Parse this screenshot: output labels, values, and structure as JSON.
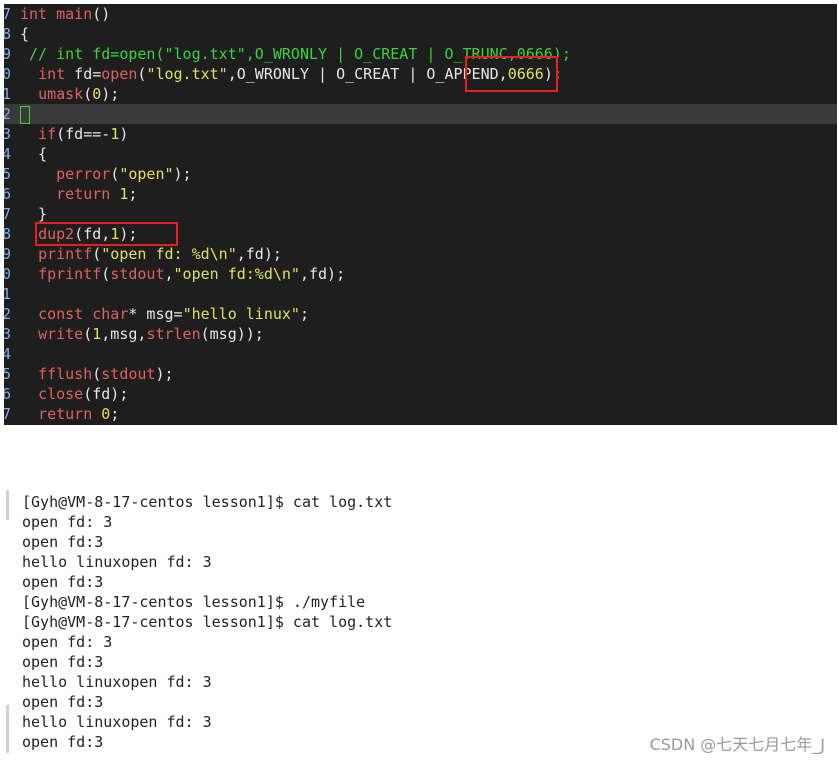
{
  "editor": {
    "lines": [
      {
        "gutter": "7",
        "parts": [
          [
            "kw",
            "int"
          ],
          [
            "plain",
            " "
          ],
          [
            "fn",
            "main"
          ],
          [
            "plain",
            "()"
          ]
        ]
      },
      {
        "gutter": "8",
        "parts": [
          [
            "plain",
            "{"
          ]
        ]
      },
      {
        "gutter": "9",
        "parts": [
          [
            "cm",
            " // int fd=open(\"log.txt\",O_WRONLY | O_CREAT | O_TRUNC,0666);"
          ]
        ]
      },
      {
        "gutter": "0",
        "parts": [
          [
            "plain",
            "  "
          ],
          [
            "kw",
            "int"
          ],
          [
            "plain",
            " fd="
          ],
          [
            "fn",
            "open"
          ],
          [
            "plain",
            "("
          ],
          [
            "str",
            "\"log.txt\""
          ],
          [
            "plain",
            ",O_WRONLY | O_CREAT | O_APPEND,"
          ],
          [
            "num",
            "0666"
          ],
          [
            "plain",
            ");"
          ]
        ]
      },
      {
        "gutter": "1",
        "parts": [
          [
            "plain",
            "  "
          ],
          [
            "fn",
            "umask"
          ],
          [
            "plain",
            "("
          ],
          [
            "num",
            "0"
          ],
          [
            "plain",
            ");"
          ]
        ]
      },
      {
        "gutter": "2",
        "parts": [
          [
            "cursor",
            ""
          ]
        ],
        "current": true
      },
      {
        "gutter": "3",
        "parts": [
          [
            "plain",
            "  "
          ],
          [
            "kw",
            "if"
          ],
          [
            "plain",
            "(fd==-"
          ],
          [
            "num",
            "1"
          ],
          [
            "plain",
            ")"
          ]
        ]
      },
      {
        "gutter": "4",
        "parts": [
          [
            "plain",
            "  {"
          ]
        ]
      },
      {
        "gutter": "5",
        "parts": [
          [
            "plain",
            "    "
          ],
          [
            "fn",
            "perror"
          ],
          [
            "plain",
            "("
          ],
          [
            "str",
            "\"open\""
          ],
          [
            "plain",
            ");"
          ]
        ]
      },
      {
        "gutter": "6",
        "parts": [
          [
            "plain",
            "    "
          ],
          [
            "kw",
            "return"
          ],
          [
            "plain",
            " "
          ],
          [
            "num",
            "1"
          ],
          [
            "plain",
            ";"
          ]
        ]
      },
      {
        "gutter": "7",
        "parts": [
          [
            "plain",
            "  }"
          ]
        ]
      },
      {
        "gutter": "8",
        "parts": [
          [
            "plain",
            "  "
          ],
          [
            "fn",
            "dup2"
          ],
          [
            "plain",
            "(fd,"
          ],
          [
            "num",
            "1"
          ],
          [
            "plain",
            ");"
          ]
        ]
      },
      {
        "gutter": "9",
        "parts": [
          [
            "plain",
            "  "
          ],
          [
            "fn",
            "printf"
          ],
          [
            "plain",
            "("
          ],
          [
            "str",
            "\"open fd: %d\\n\""
          ],
          [
            "plain",
            ",fd);"
          ]
        ]
      },
      {
        "gutter": "0",
        "parts": [
          [
            "plain",
            "  "
          ],
          [
            "fn",
            "fprintf"
          ],
          [
            "plain",
            "("
          ],
          [
            "kw",
            "stdout"
          ],
          [
            "plain",
            ","
          ],
          [
            "str",
            "\"open fd:%d\\n\""
          ],
          [
            "plain",
            ",fd);"
          ]
        ]
      },
      {
        "gutter": "1",
        "parts": [
          [
            "plain",
            ""
          ]
        ]
      },
      {
        "gutter": "2",
        "parts": [
          [
            "plain",
            "  "
          ],
          [
            "kw",
            "const"
          ],
          [
            "plain",
            " "
          ],
          [
            "kw",
            "char"
          ],
          [
            "plain",
            "* msg="
          ],
          [
            "str",
            "\"hello linux\""
          ],
          [
            "plain",
            ";"
          ]
        ]
      },
      {
        "gutter": "3",
        "parts": [
          [
            "plain",
            "  "
          ],
          [
            "fn",
            "write"
          ],
          [
            "plain",
            "("
          ],
          [
            "num",
            "1"
          ],
          [
            "plain",
            ",msg,"
          ],
          [
            "fn",
            "strlen"
          ],
          [
            "plain",
            "(msg));"
          ]
        ]
      },
      {
        "gutter": "4",
        "parts": [
          [
            "plain",
            ""
          ]
        ]
      },
      {
        "gutter": "5",
        "parts": [
          [
            "plain",
            "  "
          ],
          [
            "fn",
            "fflush"
          ],
          [
            "plain",
            "("
          ],
          [
            "kw",
            "stdout"
          ],
          [
            "plain",
            ");"
          ]
        ]
      },
      {
        "gutter": "6",
        "parts": [
          [
            "plain",
            "  "
          ],
          [
            "fn",
            "close"
          ],
          [
            "plain",
            "(fd);"
          ]
        ]
      },
      {
        "gutter": "7",
        "parts": [
          [
            "plain",
            "  "
          ],
          [
            "kw",
            "return"
          ],
          [
            "plain",
            " "
          ],
          [
            "num",
            "0"
          ],
          [
            "plain",
            ";"
          ]
        ]
      }
    ]
  },
  "terminal": {
    "lines": [
      "[Gyh@VM-8-17-centos lesson1]$ cat log.txt",
      "open fd: 3",
      "open fd:3",
      "hello linuxopen fd: 3",
      "open fd:3",
      "[Gyh@VM-8-17-centos lesson1]$ ./myfile",
      "[Gyh@VM-8-17-centos lesson1]$ cat log.txt",
      "open fd: 3",
      "open fd:3",
      "hello linuxopen fd: 3",
      "open fd:3",
      "hello linuxopen fd: 3",
      "open fd:3"
    ]
  },
  "watermark": "CSDN @七天七月七年_J",
  "colors": {
    "editor_bg": "#1e1e1e",
    "highlight_box": "#e62020",
    "comment": "#3ad33a",
    "keyword": "#e06060",
    "string": "#e0e060"
  }
}
